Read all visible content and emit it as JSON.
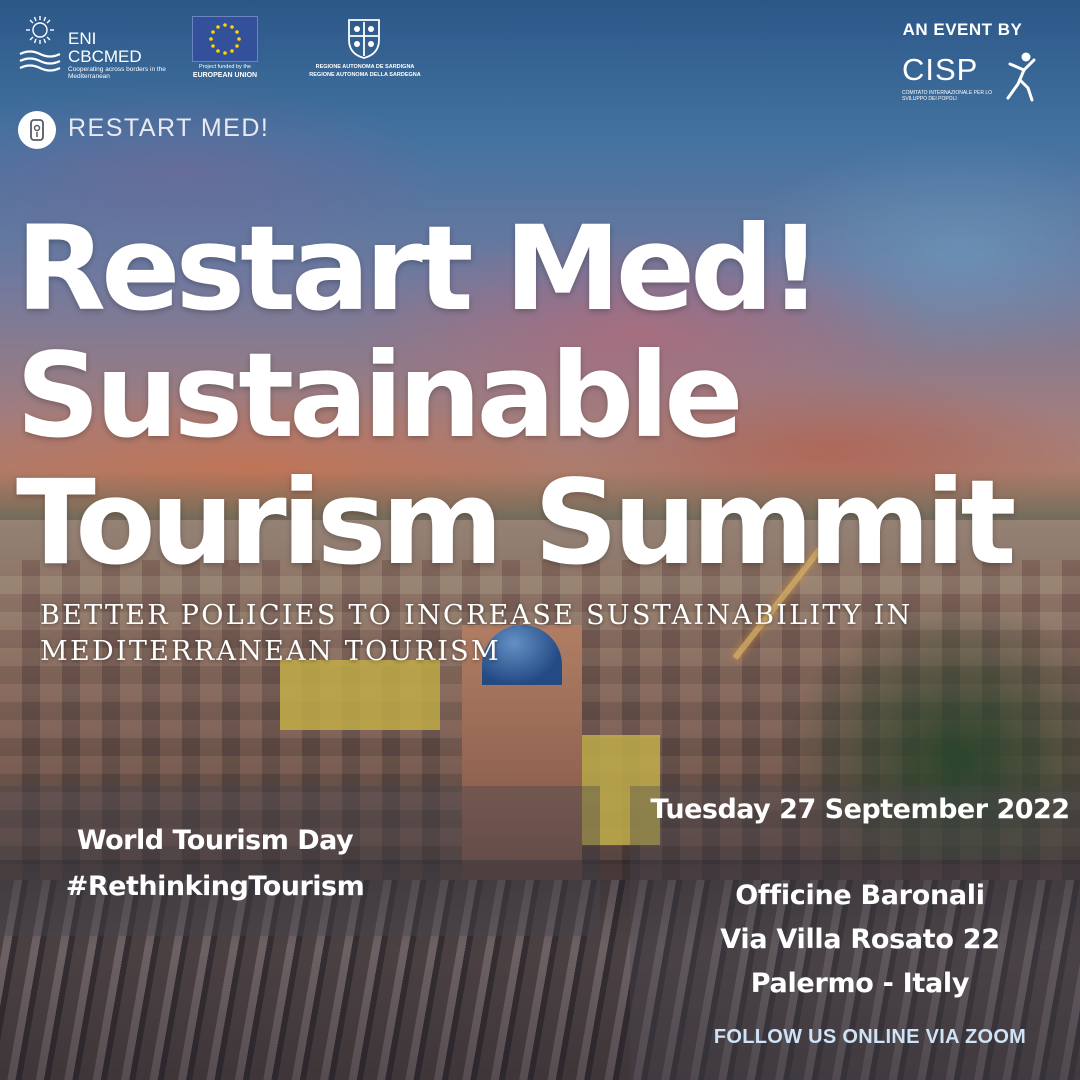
{
  "logos": {
    "eni": {
      "name_line1": "ENI",
      "name_line2": "CBCMED",
      "tagline": "Cooperating across borders in the Mediterranean"
    },
    "eu": {
      "funded_text": "Project funded by the",
      "name": "EUROPEAN UNION"
    },
    "sardegna": {
      "line1": "REGIONE AUTONOMA DE SARDIGNA",
      "line2": "REGIONE AUTONOMA DELLA SARDEGNA"
    },
    "restart": {
      "label": "RESTART MED!"
    },
    "organizer": {
      "label": "AN EVENT BY",
      "name": "CISP",
      "subtitle": "COMITATO INTERNAZIONALE PER LO SVILUPPO DEI POPOLI"
    }
  },
  "headline": {
    "line1": "Restart Med!",
    "line2": "Sustainable",
    "line3": "Tourism Summit"
  },
  "subtitle": {
    "line1": "BETTER POLICIES TO INCREASE SUSTAINABILITY IN",
    "line2": "MEDITERRANEAN TOURISM"
  },
  "event": {
    "occasion": "World Tourism Day",
    "hashtag": "#RethinkingTourism",
    "date": "Tuesday 27 September 2022",
    "venue_name": "Officine Baronali",
    "venue_address": "Via Villa Rosato 22",
    "venue_city": "Palermo - Italy",
    "online_note": "FOLLOW US ONLINE VIA ZOOM"
  },
  "colors": {
    "text": "#ffffff",
    "online_note": "#cfe3f7",
    "eu_blue": "#33509a",
    "eu_star": "#ffd400"
  }
}
